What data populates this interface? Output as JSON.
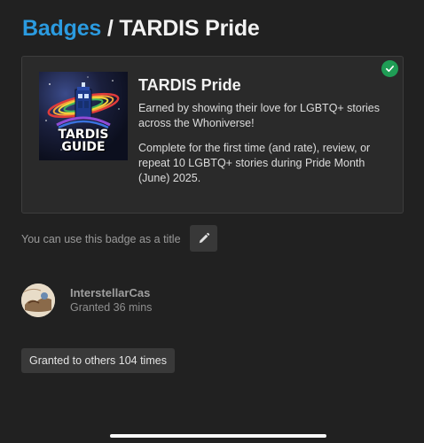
{
  "header": {
    "breadcrumb": "Badges",
    "separator": "/",
    "badge_title": "TARDIS Pride"
  },
  "badge": {
    "name": "TARDIS Pride",
    "description": "Earned by showing their love for LGBTQ+ stories across the Whoniverse!",
    "requirement": "Complete for the first time (and rate), review, or repeat 10 LGBTQ+ stories during Pride Month (June) 2025.",
    "image_text": "TARDIS GUIDE",
    "image_text_line1": "TARDIS",
    "image_text_line2": "GUIDE",
    "earned": true,
    "check_color": "#1f9d55"
  },
  "title_option": {
    "text": "You can use this badge as a title",
    "edit_icon": "pencil-icon"
  },
  "grant": {
    "user": "InterstellarCas",
    "time": "Granted 36 mins"
  },
  "others": {
    "label": "Granted to others 104 times"
  },
  "colors": {
    "background": "#212121",
    "accent": "#2b9be0",
    "card": "#2a2a2a"
  }
}
